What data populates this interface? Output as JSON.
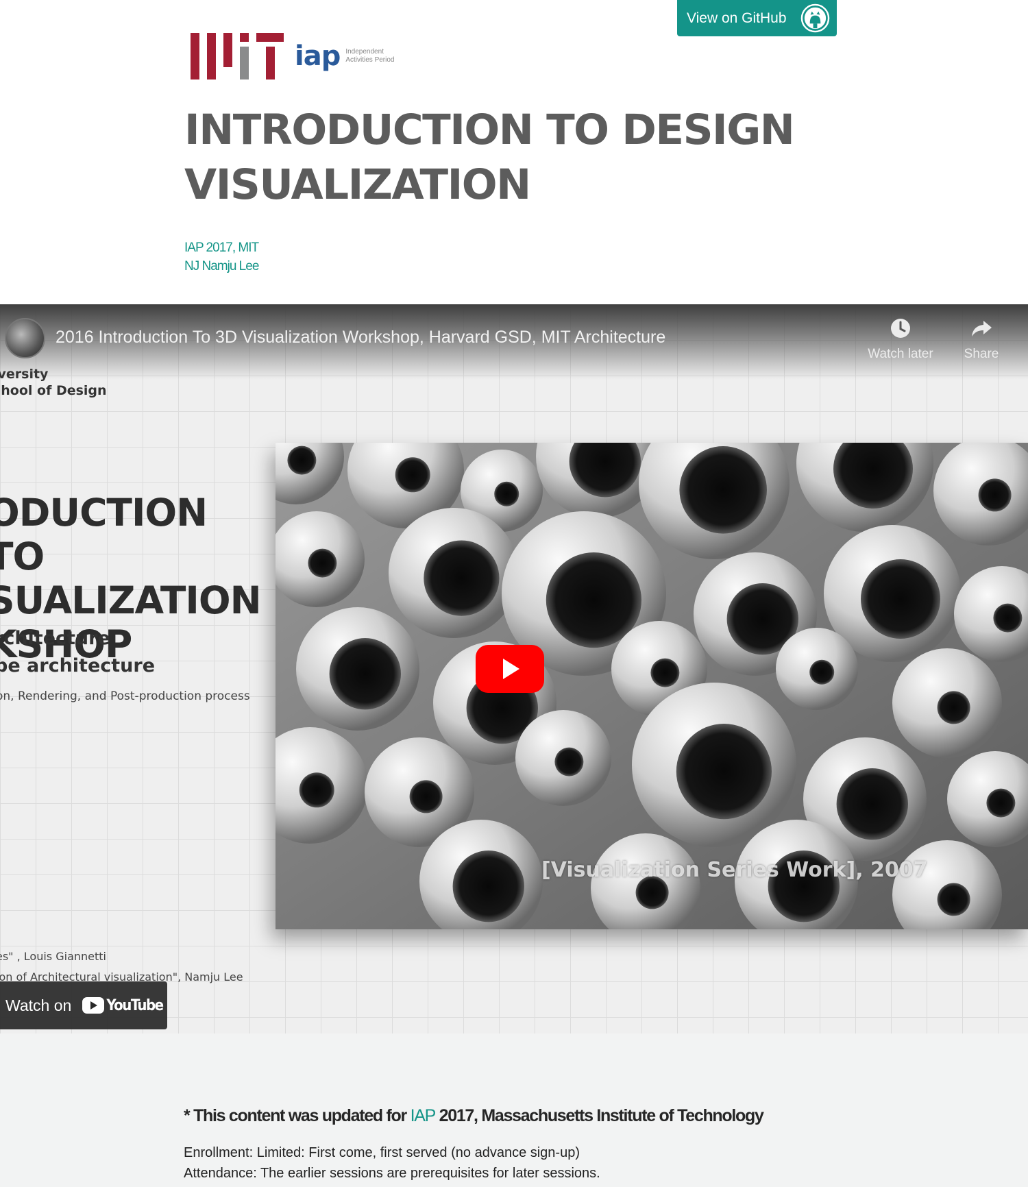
{
  "github": {
    "label": "View on GitHub",
    "icon": "github-octocat-icon"
  },
  "logos": {
    "mit": "MIT",
    "iap_word": "iap",
    "iap_sub_line1": "Independent",
    "iap_sub_line2": "Activities Period"
  },
  "header": {
    "title_line1": "INTRODUCTION TO DESIGN",
    "title_line2": "VISUALIZATION",
    "meta_line1": "IAP 2017, MIT",
    "meta_line2": "NJ Namju Lee"
  },
  "video": {
    "title": "2016 Introduction To 3D Visualization Workshop, Harvard GSD, MIT Architecture",
    "watch_later": "Watch later",
    "share": "Share",
    "watch_on": "Watch on",
    "youtube": "YouTube",
    "slide": {
      "school_line1": "iversity",
      "school_line2": "chool of Design",
      "big_line1": "ODUCTION TO",
      "big_line2": "SUALIZATION",
      "big_line3": "KSHOP",
      "sub1": "rchitecture",
      "sub2": "pe architecture",
      "sub3": "on, Rendering,  and Post-production process",
      "ref1": "es\" , Louis Giannetti",
      "ref2": "ion of Architectural visualization\", Namju Lee"
    },
    "photo_caption": "[Visualization Series Work], 2007"
  },
  "content": {
    "notice_prefix": "* This content was updated for ",
    "notice_link": "IAP",
    "notice_suffix": " 2017, Massachusetts Institute of Technology",
    "enrollment": "Enrollment: Limited: First come, first served (no advance sign-up)",
    "attendance": "Attendance: The earlier sessions are prerequisites for later sessions."
  },
  "colors": {
    "accent": "#159588",
    "github_button": "#149489",
    "mit_red": "#a31f34",
    "mit_gray": "#8a8b8c",
    "youtube_red": "#ff0000"
  }
}
